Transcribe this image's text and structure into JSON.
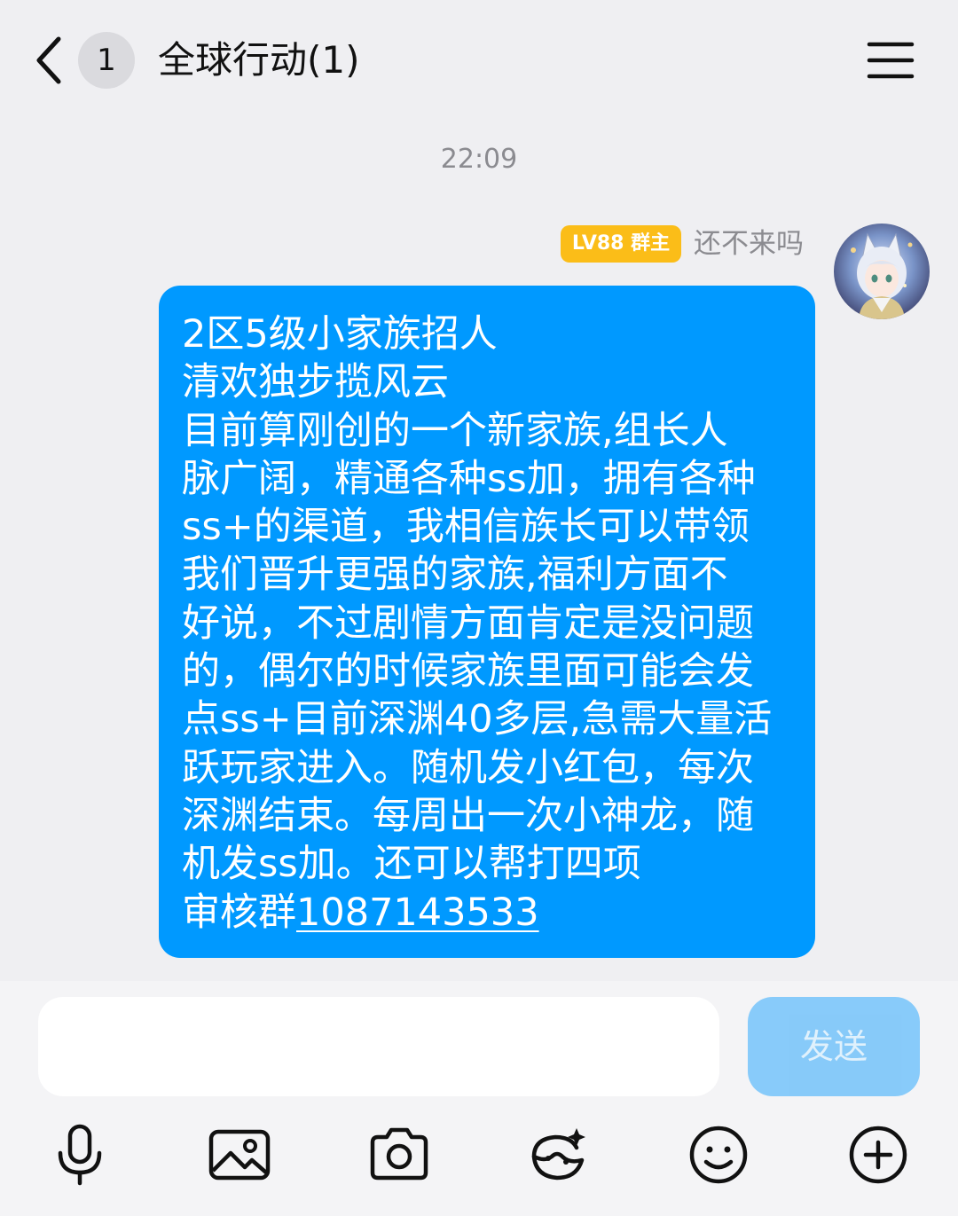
{
  "header": {
    "back_icon": "chevron-left-icon",
    "unread_count": "1",
    "title": "全球行动(1)",
    "menu_icon": "hamburger-menu-icon"
  },
  "messages": [
    {
      "time": "22:09",
      "sender": {
        "level_badge": "LV88 群主",
        "name": "还不来吗",
        "avatar_icon": "anime-character-avatar",
        "badge_color": "#fbbd18"
      },
      "bubble_color": "#0099ff",
      "lines": [
        "2区5级小家族招人",
        "清欢独步揽风云",
        "目前算刚创的一个新家族,组长人",
        "脉广阔，精通各种ss加，拥有各种",
        "ss+的渠道，我相信族长可以带领",
        "我们晋升更强的家族,福利方面不",
        "好说，不过剧情方面肯定是没问题",
        "的，偶尔的时候家族里面可能会发",
        "点ss+目前深渊40多层,急需大量活",
        "跃玩家进入。随机发小红包，每次",
        "深渊结束。每周出一次小神龙，随",
        "机发ss加。还可以帮打四项"
      ],
      "last_line_prefix": "审核群",
      "group_link": "1087143533"
    }
  ],
  "input": {
    "value": "",
    "send_label": "发送",
    "send_color": "#82c8fa"
  },
  "toolbar": [
    {
      "icon": "microphone-icon"
    },
    {
      "icon": "image-gallery-icon"
    },
    {
      "icon": "camera-icon"
    },
    {
      "icon": "sticker-icon"
    },
    {
      "icon": "emoji-smile-icon"
    },
    {
      "icon": "plus-circle-icon"
    }
  ]
}
